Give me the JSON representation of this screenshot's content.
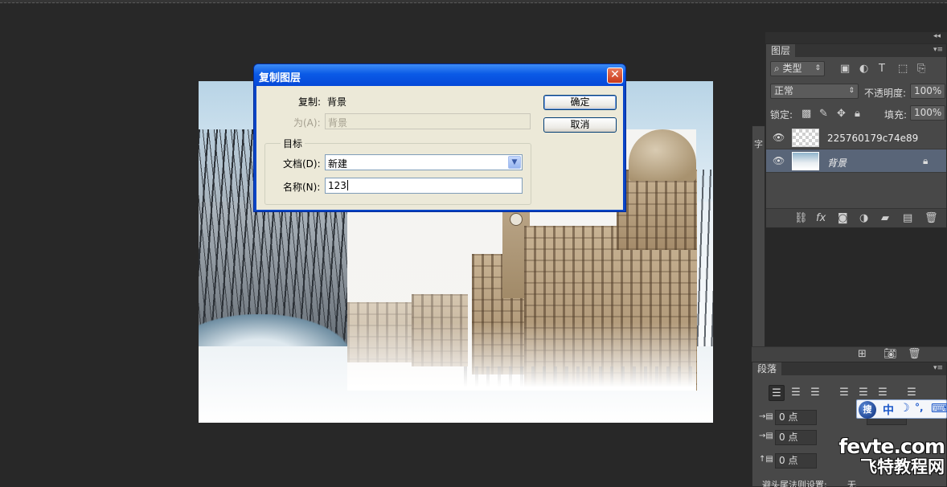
{
  "dialog": {
    "title": "复制图层",
    "close_glyph": "✕",
    "duplicate_label": "复制:",
    "duplicate_value": "背景",
    "as_label": "为(A):",
    "as_value": "背景",
    "group_label": "目标",
    "document_label": "文档(D):",
    "document_value": "新建",
    "name_label": "名称(N):",
    "name_value": "123",
    "ok_label": "确定",
    "cancel_label": "取消"
  },
  "layers_panel": {
    "tab_label": "图层",
    "filter_label": "类型",
    "blend_mode": "正常",
    "opacity_label": "不透明度:",
    "opacity_value": "100%",
    "lock_label": "锁定:",
    "fill_label": "填充:",
    "fill_value": "100%",
    "layers": [
      {
        "name": "225760179c74e89",
        "selected": false
      },
      {
        "name": "背景",
        "selected": true
      }
    ]
  },
  "side_panel": {
    "tab_label": "字"
  },
  "paragraph_panel": {
    "tab_label": "段落",
    "indent_left_value": "0 点",
    "indent_first_value": "0 点",
    "space_before_value": "0 点",
    "hyphenation_label": "避头尾法则设置:",
    "hyphenation_value": "无"
  },
  "ime": {
    "logo": "搜",
    "mode": "中",
    "moon": "☽",
    "punct": "°,",
    "keyboard": "⌨"
  },
  "watermark": {
    "line1": "fevte.com",
    "line2": "飞特教程网"
  },
  "colors": {
    "workspace": "#282828",
    "panel": "#484848",
    "xp_title_blue": "#0a5ae6",
    "selected_layer": "#596578"
  }
}
